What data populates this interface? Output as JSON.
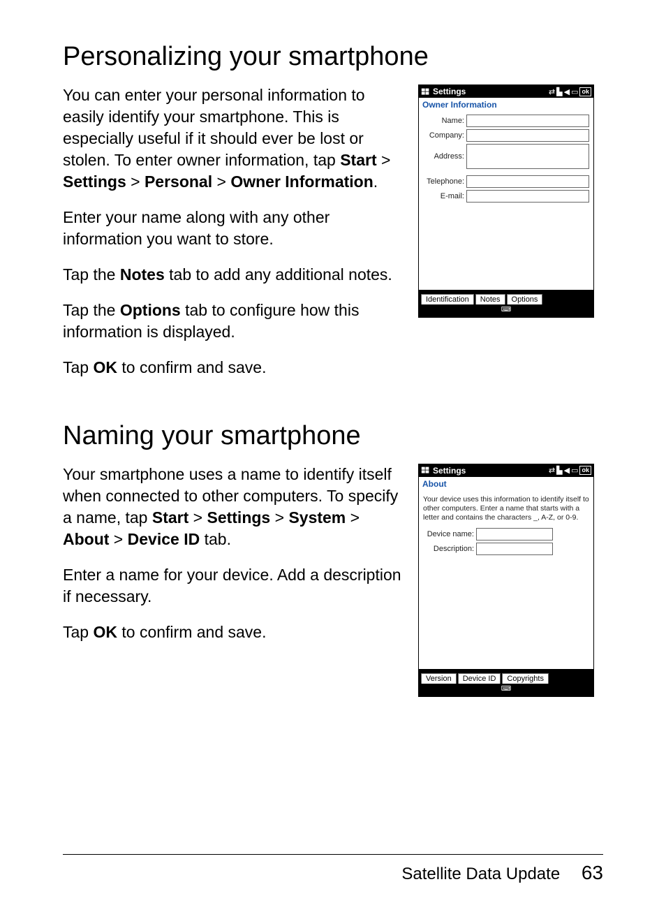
{
  "section1": {
    "heading": "Personalizing your smartphone",
    "p1a": "You can enter your personal information to easily identify your smartphone. This is especially useful if it should ever be lost or stolen. To enter owner information, tap ",
    "p1_start": "Start",
    "gt1": " > ",
    "p1_settings": "Settings",
    "gt2": " > ",
    "p1_personal": "Personal",
    "gt3": " > ",
    "p1_owner": "Owner Information",
    "p1_dot": ".",
    "p2": "Enter your name along with any other information you want to store.",
    "p3a": "Tap the ",
    "p3_notes": "Notes",
    "p3b": " tab to add any additional notes.",
    "p4a": "Tap the ",
    "p4_options": "Options",
    "p4b": " tab to configure how this information is displayed.",
    "p5a": "Tap ",
    "p5_ok": "OK",
    "p5b": " to confirm and save."
  },
  "shot1": {
    "title": "Settings",
    "subheader": "Owner Information",
    "labels": {
      "name": "Name:",
      "company": "Company:",
      "address": "Address:",
      "telephone": "Telephone:",
      "email": "E-mail:"
    },
    "tabs": {
      "t1": "Identification",
      "t2": "Notes",
      "t3": "Options"
    },
    "ok": "ok"
  },
  "section2": {
    "heading": "Naming your smartphone",
    "p1a": "Your smartphone uses a name to identify itself when connected to other computers. To specify a name, tap ",
    "p1_start": "Start",
    "gt1": " > ",
    "p1_settings": "Settings",
    "gt2": " > ",
    "p1_system": "System",
    "gt3": " > ",
    "p1_about": "About",
    "gt4": " > ",
    "p1_devid": "Device ID",
    "p1b": " tab.",
    "p2": "Enter a name for your device. Add a description if necessary.",
    "p3a": "Tap ",
    "p3_ok": "OK",
    "p3b": " to confirm and save."
  },
  "shot2": {
    "title": "Settings",
    "subheader": "About",
    "desc": "Your device uses this information to identify itself to other computers. Enter a name that starts with a letter and contains the characters _, A-Z, or 0-9.",
    "labels": {
      "devname": "Device name:",
      "description": "Description:"
    },
    "tabs": {
      "t1": "Version",
      "t2": "Device ID",
      "t3": "Copyrights"
    },
    "ok": "ok"
  },
  "footer": {
    "label": "Satellite Data Update",
    "page": "63"
  }
}
